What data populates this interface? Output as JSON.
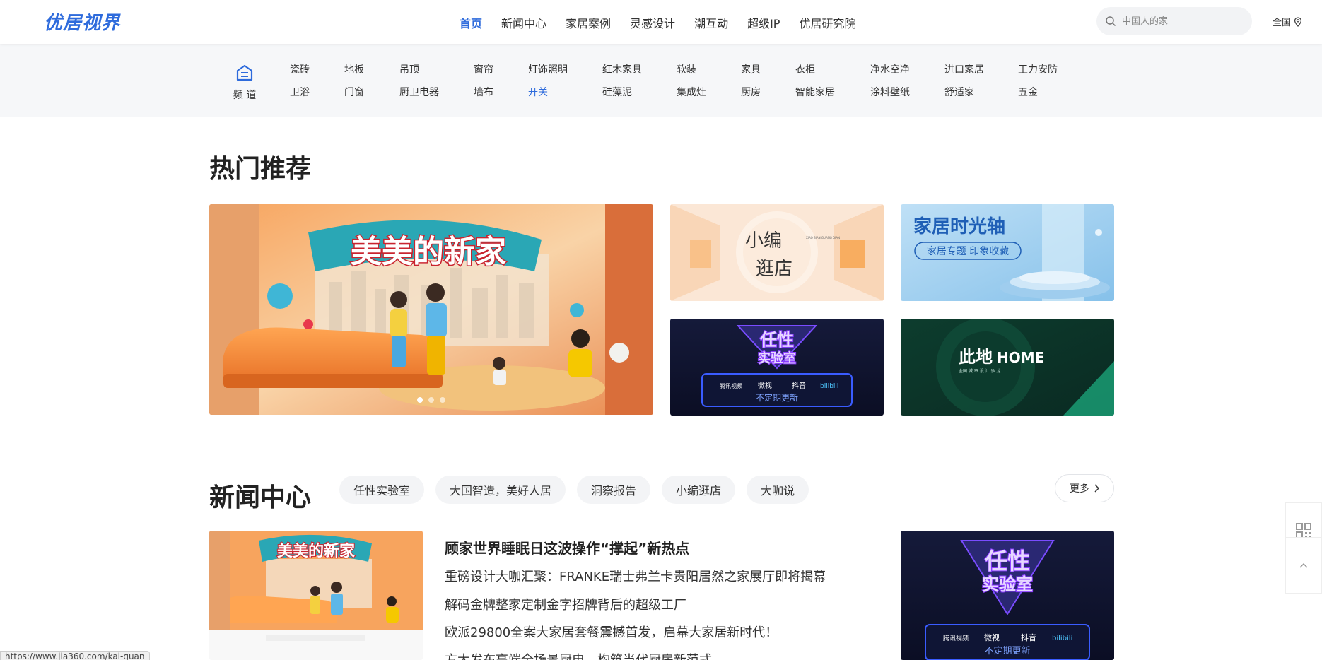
{
  "header": {
    "logo": "优居视界",
    "nav": [
      "首页",
      "新闻中心",
      "家居案例",
      "灵感设计",
      "潮互动",
      "超级IP",
      "优居研究院"
    ],
    "active_nav": "首页",
    "search_placeholder": "中国人的家",
    "region": "全国"
  },
  "channels": {
    "head_label": "频 道",
    "row1": [
      "瓷砖",
      "地板",
      "吊顶",
      "窗帘",
      "灯饰照明",
      "红木家具",
      "软装",
      "家具",
      "衣柜",
      "净水空净",
      "进口家居",
      "王力安防"
    ],
    "row2": [
      "卫浴",
      "门窗",
      "厨卫电器",
      "墙布",
      "开关",
      "硅藻泥",
      "集成灶",
      "厨房",
      "智能家居",
      "涂料壁纸",
      "舒适家",
      "五金"
    ],
    "active": "开关"
  },
  "hot": {
    "title": "热门推荐",
    "main_banner_text": "美美的新家",
    "tiles": [
      {
        "line1": "小编",
        "line2": "逛店",
        "sub": "XIAO BIAN GUANG DIAN"
      },
      {
        "line1": "家居时光轴",
        "line2": "家居专题 印象收藏"
      },
      {
        "line1": "任性",
        "line2": "实验室",
        "platforms": [
          "腾讯视频",
          "微视",
          "抖音",
          "bilibili"
        ],
        "note": "不定期更新"
      },
      {
        "line1": "此地",
        "line2": "HOME",
        "sub": "全国 城 市 设 计 沙 龙"
      }
    ]
  },
  "news": {
    "title": "新闻中心",
    "tabs": [
      "任性实验室",
      "大国智造，美好人居",
      "洞察报告",
      "小编逛店",
      "大咖说"
    ],
    "more_label": "更多",
    "headline": "顾家世界睡眠日这波操作“撑起”新热点",
    "items": [
      "重磅设计大咖汇聚：FRANKE瑞士弗兰卡贵阳居然之家展厅即将揭幕",
      "解码金牌整家定制金字招牌背后的超级工厂",
      "欧派29800全案大家居套餐震撼首发，启幕大家居新时代！",
      "方太发布高端全场景厨电，构筑当代厨房新范式"
    ],
    "thumb_text": "美美的新家",
    "right_tile": {
      "line1": "任性",
      "line2": "实验室",
      "platforms": [
        "腾讯视频",
        "微视",
        "抖音",
        "bilibili"
      ],
      "note": "不定期更新"
    }
  },
  "status_url": "https://www.jia360.com/kai-guan"
}
